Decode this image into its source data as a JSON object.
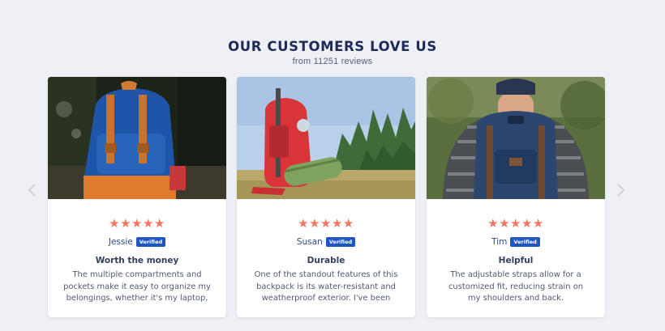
{
  "section": {
    "title": "OUR CUSTOMERS LOVE US",
    "subtitle": "from 11251 reviews"
  },
  "navigation": {
    "prev_icon": "chevron-left-icon",
    "next_icon": "chevron-right-icon"
  },
  "colors": {
    "star": "#f47561",
    "badge": "#1f54c4",
    "title": "#1d2a5a",
    "background": "#eef0f5"
  },
  "reviews": [
    {
      "stars": "★★★★★",
      "rating": 5,
      "author": "Jessie",
      "badge": "Verified",
      "title": "Worth the money",
      "body": "The multiple compartments and pockets make it easy to organize my belongings, whether it's my laptop, water bottle, or snacks."
    },
    {
      "stars": "★★★★★",
      "rating": 5,
      "author": "Susan",
      "badge": "Verified",
      "title": "Durable",
      "body": "One of the standout features of this backpack is its water-resistant and weatherproof exterior. I've been caught in the rain and my gear stayed dry."
    },
    {
      "stars": "★★★★★",
      "rating": 5,
      "author": "Tim",
      "badge": "Verified",
      "title": "Helpful",
      "body": "The adjustable straps allow for a customized fit, reducing strain on my shoulders and back."
    }
  ]
}
